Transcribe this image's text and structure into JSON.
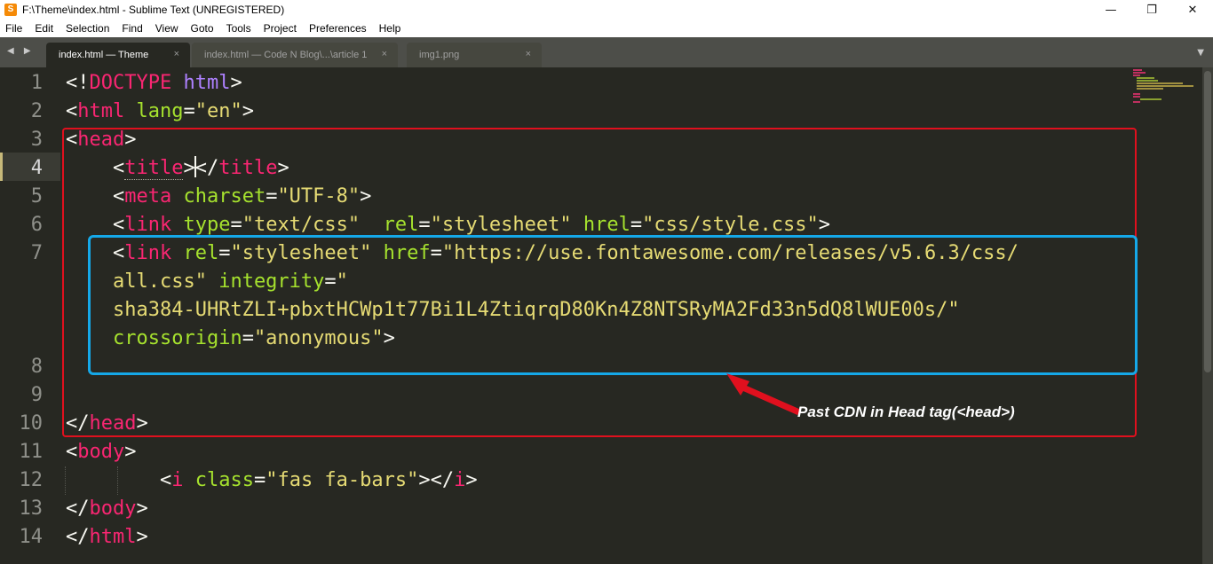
{
  "window": {
    "title": "F:\\Theme\\index.html - Sublime Text (UNREGISTERED)",
    "app_icon_glyph": "S",
    "controls": {
      "minimize": "—",
      "maximize": "❐",
      "close": "✕"
    }
  },
  "menu": [
    "File",
    "Edit",
    "Selection",
    "Find",
    "View",
    "Goto",
    "Tools",
    "Project",
    "Preferences",
    "Help"
  ],
  "tabs": [
    {
      "label": "index.html — Theme",
      "active": true,
      "close": "×"
    },
    {
      "label": "index.html — Code N Blog\\...\\article 1",
      "active": false,
      "close": "×"
    },
    {
      "label": "img1.png",
      "active": false,
      "close": "×"
    }
  ],
  "tabbar": {
    "nav": "◀ ▶",
    "dropdown": "▼"
  },
  "editor": {
    "line_numbers": [
      "1",
      "2",
      "3",
      "4",
      "5",
      "6",
      "7",
      "8",
      "9",
      "10",
      "11",
      "12",
      "13",
      "14"
    ],
    "current_line": "4",
    "lines": [
      [
        [
          "p",
          "<!"
        ],
        [
          "t",
          "DOCTYPE"
        ],
        [
          "p",
          " "
        ],
        [
          "k",
          "html"
        ],
        [
          "p",
          ">"
        ]
      ],
      [
        [
          "p",
          "<"
        ],
        [
          "t",
          "html"
        ],
        [
          "p",
          " "
        ],
        [
          "a",
          "lang"
        ],
        [
          "p",
          "="
        ],
        [
          "s",
          "\"en\""
        ],
        [
          "p",
          ">"
        ]
      ],
      [
        [
          "p",
          "<"
        ],
        [
          "t",
          "head"
        ],
        [
          "p",
          ">"
        ]
      ],
      [
        [
          "p",
          "    <"
        ],
        [
          "t",
          "title"
        ],
        [
          "p",
          ">"
        ],
        [
          "cursor",
          ""
        ],
        [
          "p",
          "</"
        ],
        [
          "t",
          "title"
        ],
        [
          "p",
          ">"
        ]
      ],
      [
        [
          "p",
          "    <"
        ],
        [
          "t",
          "meta"
        ],
        [
          "p",
          " "
        ],
        [
          "a",
          "charset"
        ],
        [
          "p",
          "="
        ],
        [
          "s",
          "\"UTF-8\""
        ],
        [
          "p",
          ">"
        ]
      ],
      [
        [
          "p",
          "    <"
        ],
        [
          "t",
          "link"
        ],
        [
          "p",
          " "
        ],
        [
          "a",
          "type"
        ],
        [
          "p",
          "="
        ],
        [
          "s",
          "\"text/css\""
        ],
        [
          "p",
          "  "
        ],
        [
          "a",
          "rel"
        ],
        [
          "p",
          "="
        ],
        [
          "s",
          "\"stylesheet\""
        ],
        [
          "p",
          " "
        ],
        [
          "a",
          "hrel"
        ],
        [
          "p",
          "="
        ],
        [
          "s",
          "\"css/style.css\""
        ],
        [
          "p",
          ">"
        ]
      ],
      [
        [
          "p",
          "    <"
        ],
        [
          "t",
          "link"
        ],
        [
          "p",
          " "
        ],
        [
          "a",
          "rel"
        ],
        [
          "p",
          "="
        ],
        [
          "s",
          "\"stylesheet\""
        ],
        [
          "p",
          " "
        ],
        [
          "a",
          "href"
        ],
        [
          "p",
          "="
        ],
        [
          "s",
          "\"https://use.fontawesome.com/releases/v5.6.3/css/"
        ]
      ],
      [
        [
          "s",
          "    all.css\""
        ],
        [
          "p",
          " "
        ],
        [
          "a",
          "integrity"
        ],
        [
          "p",
          "="
        ],
        [
          "s",
          "\""
        ]
      ],
      [
        [
          "s",
          "    sha384-UHRtZLI+pbxtHCWp1t77Bi1L4ZtiqrqD80Kn4Z8NTSRyMA2Fd33n5dQ8lWUE00s/\""
        ]
      ],
      [
        [
          "p",
          "    "
        ],
        [
          "a",
          "crossorigin"
        ],
        [
          "p",
          "="
        ],
        [
          "s",
          "\"anonymous\""
        ],
        [
          "p",
          ">"
        ]
      ],
      [
        [
          "p",
          ""
        ]
      ],
      [
        [
          "p",
          ""
        ]
      ],
      [
        [
          "p",
          "</"
        ],
        [
          "t",
          "head"
        ],
        [
          "p",
          ">"
        ]
      ],
      [
        [
          "p",
          "<"
        ],
        [
          "t",
          "body"
        ],
        [
          "p",
          ">"
        ]
      ],
      [
        [
          "p",
          "        <"
        ],
        [
          "t",
          "i"
        ],
        [
          "p",
          " "
        ],
        [
          "a",
          "class"
        ],
        [
          "p",
          "="
        ],
        [
          "s",
          "\"fas fa-bars\""
        ],
        [
          "p",
          "></"
        ],
        [
          "t",
          "i"
        ],
        [
          "p",
          ">"
        ]
      ],
      [
        [
          "p",
          "</"
        ],
        [
          "t",
          "body"
        ],
        [
          "p",
          ">"
        ]
      ],
      [
        [
          "p",
          "</"
        ],
        [
          "t",
          "html"
        ],
        [
          "p",
          ">"
        ]
      ]
    ]
  },
  "annotation": {
    "text": "Past CDN in Head tag(<head>)"
  },
  "colors": {
    "background": "#272822",
    "tag": "#f92672",
    "attribute": "#a6e22e",
    "string": "#e6db74",
    "keyword": "#ae81ff",
    "red_box": "#e0101e",
    "blue_box": "#15a8e8",
    "arrow": "#e0101e"
  }
}
